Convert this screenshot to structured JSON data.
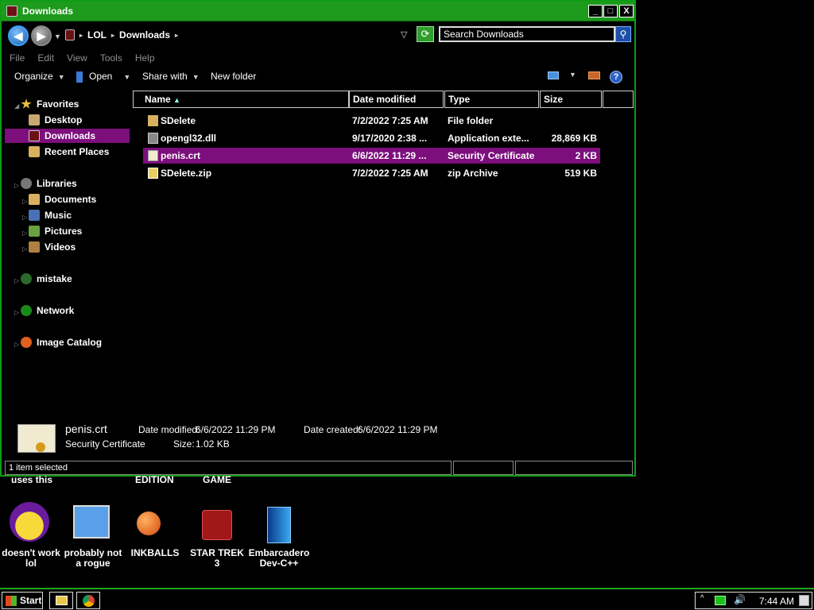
{
  "window": {
    "title": "Downloads",
    "controls": {
      "minimize": "_",
      "maximize": "□",
      "close": "X"
    }
  },
  "address": {
    "breadcrumb": [
      "LOL",
      "Downloads"
    ],
    "search_placeholder": "Search Downloads"
  },
  "menu": [
    "File",
    "Edit",
    "View",
    "Tools",
    "Help"
  ],
  "toolbar": {
    "organize": "Organize",
    "open": "Open",
    "share_with": "Share with",
    "new_folder": "New folder",
    "help": "?"
  },
  "nav": {
    "favorites": "Favorites",
    "desktop": "Desktop",
    "downloads": "Downloads",
    "recent": "Recent Places",
    "libraries": "Libraries",
    "documents": "Documents",
    "music": "Music",
    "pictures": "Pictures",
    "videos": "Videos",
    "mistake": "mistake",
    "network": "Network",
    "image_catalog": "Image Catalog"
  },
  "columns": {
    "name": "Name",
    "date": "Date modified",
    "type": "Type",
    "size": "Size"
  },
  "files": [
    {
      "name": "SDelete",
      "date": "7/2/2022 7:25 AM",
      "type": "File folder",
      "size": ""
    },
    {
      "name": "opengl32.dll",
      "date": "9/17/2020 2:38 ...",
      "type": "Application exte...",
      "size": "28,869 KB"
    },
    {
      "name": "penis.crt",
      "date": "6/6/2022 11:29 ...",
      "type": "Security Certificate",
      "size": "2 KB"
    },
    {
      "name": "SDelete.zip",
      "date": "7/2/2022 7:25 AM",
      "type": "zip Archive",
      "size": "519 KB"
    }
  ],
  "details": {
    "filename": "penis.crt",
    "filetype": "Security Certificate",
    "modified_label": "Date modified:",
    "modified_value": "6/6/2022 11:29 PM",
    "size_label": "Size:",
    "size_value": "1.02 KB",
    "created_label": "Date created:",
    "created_value": "6/6/2022 11:29 PM"
  },
  "status": {
    "selected": "1 item selected"
  },
  "desktop": {
    "partial_labels": [
      "uses this",
      "EDITION",
      "GAME"
    ],
    "icons": [
      {
        "line1": "doesn't work",
        "line2": "lol"
      },
      {
        "line1": "probably not",
        "line2": "a rogue"
      },
      {
        "line1": "INKBALLS",
        "line2": ""
      },
      {
        "line1": "STAR TREK",
        "line2": "3"
      },
      {
        "line1": "Embarcadero",
        "line2": "Dev-C++"
      }
    ]
  },
  "taskbar": {
    "start": "Start",
    "clock": "7:44 AM"
  },
  "colors": {
    "accent": "#1e9a1c",
    "selection": "#7c0f7c"
  }
}
